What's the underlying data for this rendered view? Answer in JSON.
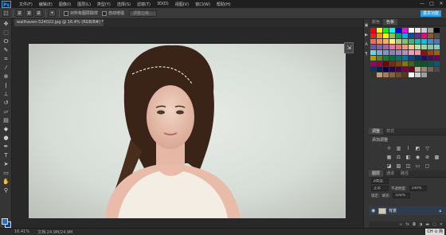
{
  "app": {
    "logo": "Ps"
  },
  "menu": {
    "items": [
      "文件(F)",
      "编辑(E)",
      "图像(I)",
      "图层(L)",
      "类型(Y)",
      "选择(S)",
      "滤镜(T)",
      "3D(D)",
      "视图(V)",
      "窗口(W)",
      "帮助(H)"
    ]
  },
  "window_controls": {
    "minimize": "—",
    "maximize": "□",
    "close": "✕"
  },
  "options_bar": {
    "tool_icon": "⬚",
    "checkbox_label_1": "对所有图层取样",
    "checkbox_label_2": "自动增强",
    "refine_button": "调整边缘...",
    "workspace": "基本功能"
  },
  "document": {
    "tab_label": "wallhaven-524022.jpg @ 16.4% (RGB/8#) *",
    "photo_alt_colors": {
      "background": "#d9dfd9",
      "hair": "#3a2418",
      "skin": "#e9c7b5",
      "dress": "#f2ece2"
    }
  },
  "status": {
    "zoom": "16.41%",
    "doc": "文档:24.9M/24.9M",
    "ime": "CH ⊙ 简"
  },
  "panels": {
    "swatches_tabs": [
      "颜色",
      "色板"
    ],
    "adjustments_tabs": [
      "调整",
      "样式"
    ],
    "adjustments_title": "添加调整",
    "layers_tabs": [
      "图层",
      "通道",
      "路径"
    ],
    "layers_kind": "ρ类型",
    "layers_blend": "正常",
    "layers_opacity_label": "不透明度:",
    "layers_opacity": "100%",
    "layers_lock_label": "锁定:",
    "layers_fill_label": "填充:",
    "layers_fill": "100%",
    "layer_name": "背景",
    "swatch_colors": [
      "#ff0000",
      "#ffff00",
      "#00ff00",
      "#00ffff",
      "#0000ff",
      "#ff00ff",
      "#ffffff",
      "#e6e6e6",
      "#cccccc",
      "#999999",
      "#000000",
      "#ee1d24",
      "#f7941d",
      "#fff200",
      "#8dc63f",
      "#00a651",
      "#00aeef",
      "#0054a6",
      "#662d91",
      "#ec008c",
      "#8b5a2b",
      "#594a42",
      "#f26c4f",
      "#f68e55",
      "#fbaf5c",
      "#fff467",
      "#acd372",
      "#7cc576",
      "#3bb878",
      "#1abbb4",
      "#00bff3",
      "#438cca",
      "#5574b9",
      "#605ca8",
      "#855fa8",
      "#a763a8",
      "#f06eaa",
      "#f26d7d",
      "#f7977a",
      "#fdc689",
      "#c4df9b",
      "#a3d39c",
      "#82ca9c",
      "#7accc8",
      "#6dcff6",
      "#7da7d9",
      "#8393ca",
      "#8781bd",
      "#a186be",
      "#bd8cbf",
      "#f49ac1",
      "#f5989d",
      "#9e0b0f",
      "#a0410d",
      "#a36209",
      "#aba000",
      "#598527",
      "#1a7b30",
      "#007236",
      "#00746b",
      "#0076a3",
      "#004b80",
      "#003471",
      "#1b1464",
      "#440e62",
      "#630460",
      "#9e005d",
      "#9e0039",
      "#790000",
      "#7b2e00",
      "#7d4900",
      "#827b00",
      "#406618",
      "#005e20",
      "#005826",
      "#005952",
      "#005b7f",
      "#003663",
      "#002157",
      "#0d004c",
      "#32004b",
      "#4b0049",
      "#7b0046",
      "#7a0026",
      "#c7b299",
      "#998675",
      "#736357",
      "#534741",
      "#37302d",
      "#c69c6d",
      "#a67c52",
      "#8c6239",
      "#754c24",
      "#603913",
      "#ffffff",
      "#d0d0d0",
      "#a0a0a0"
    ]
  }
}
